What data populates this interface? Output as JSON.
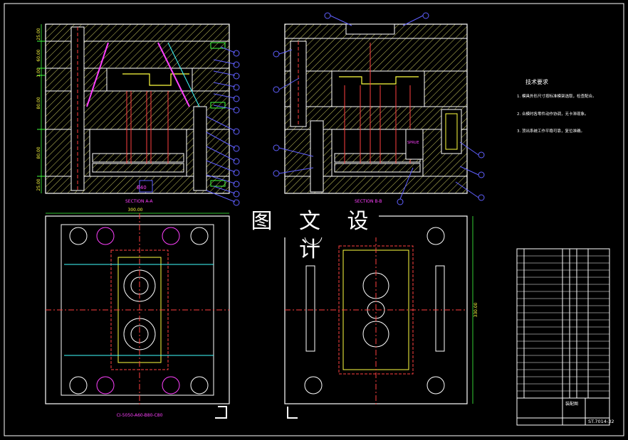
{
  "watermark": "图 文 设 计",
  "section_aa_label": "SECTION A-A",
  "section_bb_label": "SECTION B-B",
  "mold_base_label": "CI-5050-A60-B80-C80",
  "tech_title": "技术要求",
  "tech_notes": [
    "1. 模具外形尺寸按标准模架选取，检查配合。",
    "2. 合模时各零件动作协调，无卡滞现象。",
    "3. 顶出系统工作平稳可靠，复位准确。"
  ],
  "dims": {
    "overall_width": "300.00",
    "overall_height": "330.00",
    "left_stack": [
      "25.00",
      "60.00",
      "1.00",
      "80.00",
      "80.00",
      "25.00"
    ]
  },
  "plate_tag": "B40",
  "insert_tag": "SPRUE",
  "drawing_no": "ST.7014-32",
  "title_block_label": "装配图",
  "colors": {
    "background": "#000000",
    "outline": "#ffffff",
    "hatch": "#c8c860",
    "balloon": "#ff40ff",
    "pin": "#ff4040",
    "cooling": "#ff4040",
    "yellow": "#ffff40",
    "green": "#40ff40",
    "cyan": "#40ffff",
    "blue": "#6060ff"
  }
}
